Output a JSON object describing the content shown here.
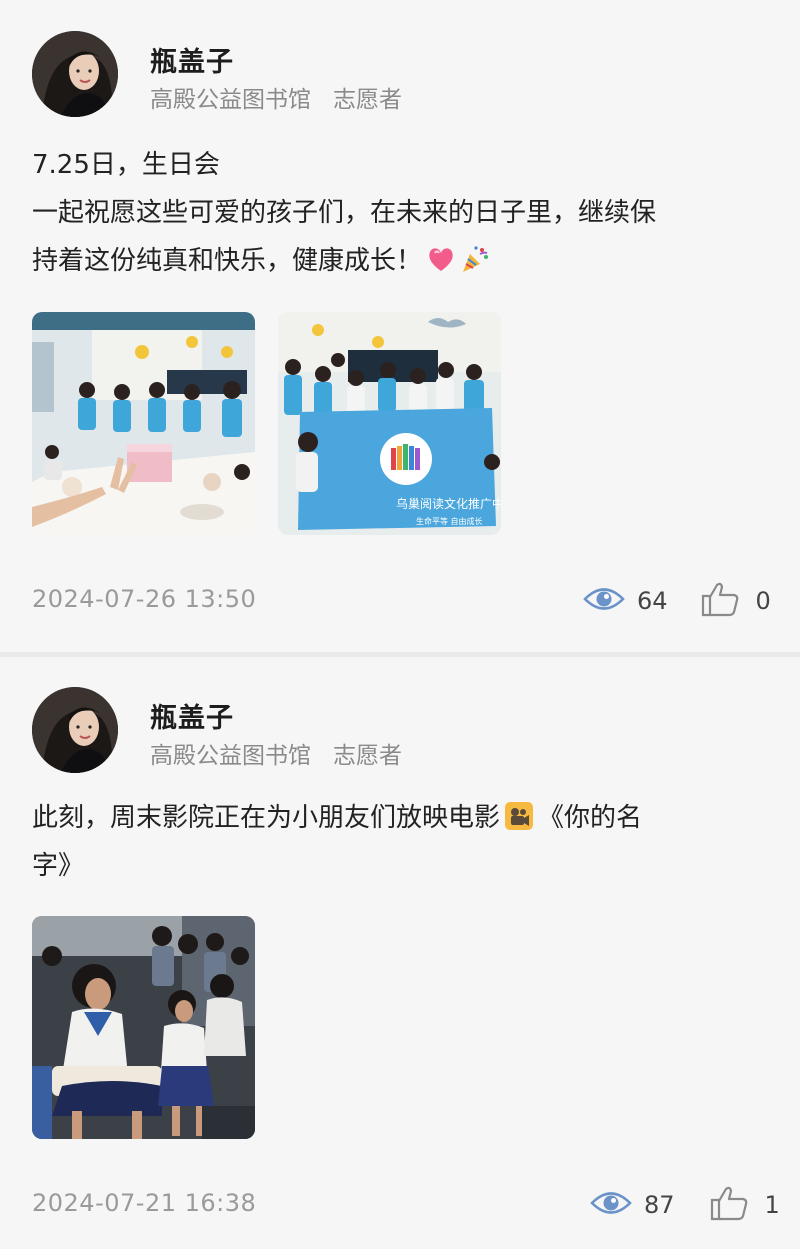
{
  "posts": [
    {
      "author": {
        "name": "瓶盖子",
        "org": "高殿公益图书馆",
        "role": "志愿者"
      },
      "lines": [
        "7.25日，生日会",
        "一起祝愿这些可爱的孩子们，在未来的日子里，继续保",
        "持着这份纯真和快乐，健康成长！"
      ],
      "emojis": [
        "heart-emoji",
        "party-popper-emoji"
      ],
      "photos": [
        {
          "description_icon": "birthday-party-photo"
        },
        {
          "description_icon": "group-banner-photo",
          "banner_text": "乌巢阅读文化推广中心",
          "banner_subtext": "生命平等  自由成长"
        }
      ],
      "timestamp": "2024-07-26 13:50",
      "views": "64",
      "likes": "0"
    },
    {
      "author": {
        "name": "瓶盖子",
        "org": "高殿公益图书馆",
        "role": "志愿者"
      },
      "lines": [
        "此刻，周末影院正在为小朋友们放映电影",
        "《你的名",
        "字》"
      ],
      "emojis": [
        "movie-camera-emoji"
      ],
      "photos": [
        {
          "description_icon": "children-watching-movie-photo"
        }
      ],
      "timestamp": "2024-07-21 16:38",
      "views": "87",
      "likes": "1"
    }
  ],
  "colors": {
    "background": "#f6f6f6",
    "text_primary": "#1d1d1d",
    "text_secondary": "#8a8a8a",
    "eye_icon": "#6b93c9",
    "like_icon": "#8a8a8a"
  }
}
